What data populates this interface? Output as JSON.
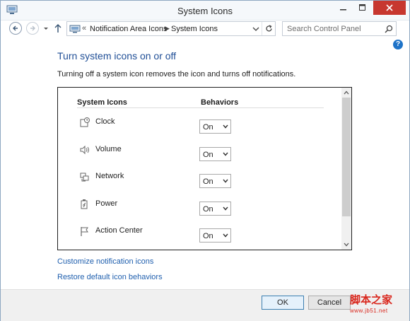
{
  "window": {
    "title": "System Icons"
  },
  "address_bar": {
    "separator": "«",
    "crumbs": [
      "Notification Area Icons",
      "System Icons"
    ],
    "crumb_arrow": "▶"
  },
  "search": {
    "placeholder": "Search Control Panel"
  },
  "help": {
    "label": "?"
  },
  "main": {
    "heading": "Turn system icons on or off",
    "description": "Turning off a system icon removes the icon and turns off notifications."
  },
  "table": {
    "columns": [
      "System Icons",
      "Behaviors"
    ],
    "rows": [
      {
        "icon": "clock-icon",
        "name": "Clock",
        "behavior": "On"
      },
      {
        "icon": "volume-icon",
        "name": "Volume",
        "behavior": "On"
      },
      {
        "icon": "network-icon",
        "name": "Network",
        "behavior": "On"
      },
      {
        "icon": "power-icon",
        "name": "Power",
        "behavior": "On"
      },
      {
        "icon": "action-center-flag-icon",
        "name": "Action Center",
        "behavior": "On"
      }
    ]
  },
  "links": {
    "customize": "Customize notification icons",
    "restore": "Restore default icon behaviors"
  },
  "footer": {
    "ok": "OK",
    "cancel": "Cancel"
  },
  "watermark": {
    "text": "脚本之家",
    "sub": "www.jb51.net"
  },
  "colors": {
    "heading": "#1f4e96",
    "link": "#1f5fae",
    "close_button": "#c7372f",
    "help_badge": "#1e73c8",
    "watermark": "#d9261c"
  }
}
